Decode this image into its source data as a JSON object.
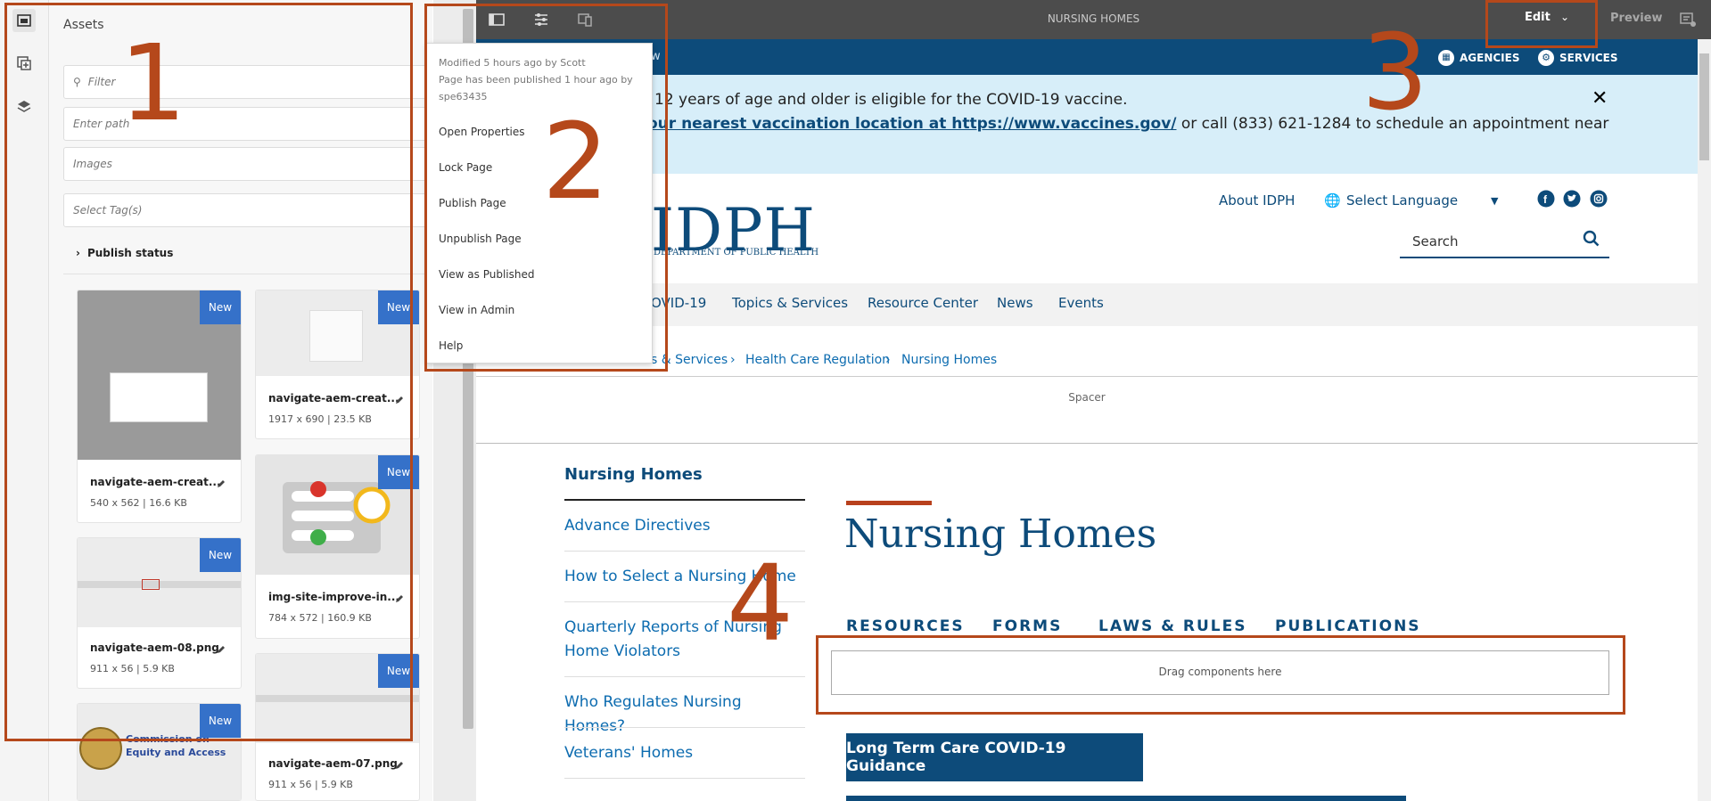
{
  "rail": {
    "icons": [
      "assets-icon",
      "components-icon",
      "layers-icon"
    ]
  },
  "assets": {
    "title": "Assets",
    "filter_placeholder": "Filter",
    "path_placeholder": "Enter path",
    "type_value": "Images",
    "tags_placeholder": "Select Tag(s)",
    "publish_status": "Publish status",
    "badge": "New",
    "items": [
      {
        "name": "navigate-aem-creat...",
        "meta": "540 x 562 | 16.6 KB"
      },
      {
        "name": "navigate-aem-creat...",
        "meta": "1917 x 690 | 23.5 KB"
      },
      {
        "name": "img-site-improve-in...",
        "meta": "784 x 572 | 160.9 KB"
      },
      {
        "name": "navigate-aem-08.png",
        "meta": "911 x 56 | 5.9 KB"
      },
      {
        "name": "navigate-aem-07.png",
        "meta": "911 x 56 | 5.9 KB"
      },
      {
        "name": "Commission on Equity and Access",
        "meta": ""
      }
    ]
  },
  "toolbar": {
    "title": "NURSING HOMES",
    "edit_label": "Edit",
    "preview_label": "Preview"
  },
  "menu": {
    "modified": "Modified 5 hours ago by Scott",
    "published": "Page has been published 1 hour ago by spe63435",
    "items": [
      "Open Properties",
      "Lock Page",
      "Publish Page",
      "Unpublish Page",
      "View as Published",
      "View in Admin",
      "Help"
    ]
  },
  "site": {
    "topbar_partial": "w",
    "agencies": "AGENCIES",
    "services": "SERVICES",
    "alert_line1": "12 years of age and older is eligible for the COVID-19 vaccine.",
    "alert_link": "our nearest vaccination location at https://www.vaccines.gov/",
    "alert_line2_rest": " or call (833) 621-1284 to schedule an appointment near",
    "logo": "IDPH",
    "logo_sub": "DEPARTMENT OF PUBLIC HEALTH",
    "about": "About IDPH",
    "language": "Select Language",
    "search_placeholder": "Search",
    "nav": [
      "OVID-19",
      "Topics & Services",
      "Resource Center",
      "News",
      "Events"
    ],
    "breadcrumb": [
      "s & Services",
      "Health Care Regulation",
      "Nursing Homes"
    ],
    "spacer": "Spacer",
    "sidebar_title": "Nursing Homes",
    "sidebar": [
      "Advance Directives",
      "How to Select a Nursing Home",
      "Quarterly Reports of Nursing Home Violators",
      "Who Regulates Nursing Homes?",
      "Veterans' Homes"
    ],
    "heading": "Nursing Homes",
    "tabs": [
      "RESOURCES",
      "FORMS",
      "LAWS & RULES",
      "PUBLICATIONS"
    ],
    "drag_label": "Drag components here",
    "cta": "Long Term Care COVID-19 Guidance"
  },
  "annotations": [
    "1",
    "2",
    "3",
    "4"
  ],
  "colors": {
    "brand": "#0d4b7a",
    "annotation": "#b5481b",
    "badge": "#3571c9"
  }
}
